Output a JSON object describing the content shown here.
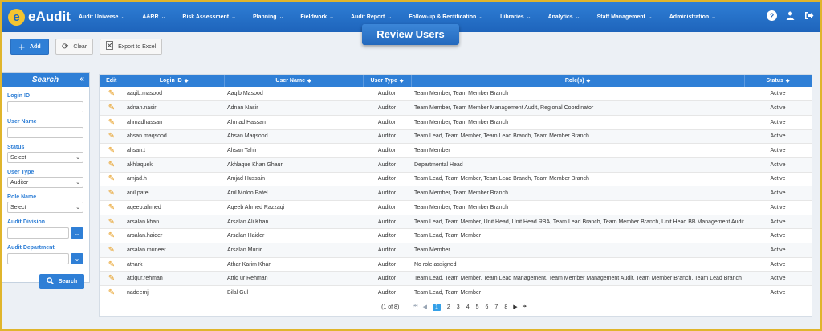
{
  "app": {
    "logo_glyph": "e",
    "name": "eAudit"
  },
  "nav": [
    {
      "label": "Audit Universe"
    },
    {
      "label": "A&RR"
    },
    {
      "label": "Risk Assessment"
    },
    {
      "label": "Planning"
    },
    {
      "label": "Fieldwork"
    },
    {
      "label": "Audit Report"
    },
    {
      "label": "Follow-up & Rectification"
    },
    {
      "label": "Libraries"
    },
    {
      "label": "Analytics"
    },
    {
      "label": "Staff Management"
    },
    {
      "label": "Administration"
    }
  ],
  "page_title": "Review Users",
  "toolbar": {
    "add": "Add",
    "clear": "Clear",
    "export": "Export to Excel"
  },
  "search": {
    "title": "Search",
    "login_id_label": "Login ID",
    "user_name_label": "User Name",
    "status_label": "Status",
    "status_value": "Select",
    "user_type_label": "User Type",
    "user_type_value": "Auditor",
    "role_name_label": "Role Name",
    "role_name_value": "Select",
    "audit_division_label": "Audit Division",
    "audit_department_label": "Audit Department",
    "search_button": "Search"
  },
  "grid": {
    "columns": [
      "Edit",
      "Login ID",
      "User Name",
      "User Type",
      "Role(s)",
      "Status"
    ],
    "rows": [
      {
        "login": "aaqib.masood",
        "name": "Aaqib Masood",
        "type": "Auditor",
        "roles": "Team Member, Team Member Branch",
        "status": "Active"
      },
      {
        "login": "adnan.nasir",
        "name": "Adnan Nasir",
        "type": "Auditor",
        "roles": "Team Member, Team Member Management Audit, Regional Coordinator",
        "status": "Active"
      },
      {
        "login": "ahmadhassan",
        "name": "Ahmad Hassan",
        "type": "Auditor",
        "roles": "Team Member, Team Member Branch",
        "status": "Active"
      },
      {
        "login": "ahsan.maqsood",
        "name": "Ahsan Maqsood",
        "type": "Auditor",
        "roles": "Team Lead, Team Member, Team Lead Branch, Team Member Branch",
        "status": "Active"
      },
      {
        "login": "ahsan.t",
        "name": "Ahsan Tahir",
        "type": "Auditor",
        "roles": "Team Member",
        "status": "Active"
      },
      {
        "login": "akhlaquek",
        "name": "Akhlaque Khan Ghauri",
        "type": "Auditor",
        "roles": "Departmental Head",
        "status": "Active"
      },
      {
        "login": "amjad.h",
        "name": "Amjad Hussain",
        "type": "Auditor",
        "roles": "Team Lead, Team Member, Team Lead Branch, Team Member Branch",
        "status": "Active"
      },
      {
        "login": "anil.patel",
        "name": "Anil Moloo Patel",
        "type": "Auditor",
        "roles": "Team Member, Team Member Branch",
        "status": "Active"
      },
      {
        "login": "aqeeb.ahmed",
        "name": "Aqeeb Ahmed Razzaqi",
        "type": "Auditor",
        "roles": "Team Member, Team Member Branch",
        "status": "Active"
      },
      {
        "login": "arsalan.khan",
        "name": "Arsalan Ali Khan",
        "type": "Auditor",
        "roles": "Team Lead, Team Member, Unit Head, Unit Head RBA, Team Lead Branch, Team Member Branch, Unit Head BB Management Audit",
        "status": "Active"
      },
      {
        "login": "arsalan.haider",
        "name": "Arsalan Haider",
        "type": "Auditor",
        "roles": "Team Lead, Team Member",
        "status": "Active"
      },
      {
        "login": "arsalan.muneer",
        "name": "Arsalan Munir",
        "type": "Auditor",
        "roles": "Team Member",
        "status": "Active"
      },
      {
        "login": "athark",
        "name": "Athar Karim Khan",
        "type": "Auditor",
        "roles": "No role assigned",
        "status": "Active"
      },
      {
        "login": "attiqur.rehman",
        "name": "Attiq ur Rehman",
        "type": "Auditor",
        "roles": "Team Lead, Team Member, Team Lead Management, Team Member Management Audit, Team Member Branch, Team Lead Branch",
        "status": "Active"
      },
      {
        "login": "nadeemj",
        "name": "Bilal Gul",
        "type": "Auditor",
        "roles": "Team Lead, Team Member",
        "status": "Active"
      }
    ]
  },
  "pager": {
    "info": "(1 of 8)",
    "pages": [
      "1",
      "2",
      "3",
      "4",
      "5",
      "6",
      "7",
      "8"
    ],
    "current": "1"
  },
  "colors": {
    "primary": "#2f7fd6",
    "accent": "#e0b52c",
    "edit_icon": "#e69712"
  }
}
